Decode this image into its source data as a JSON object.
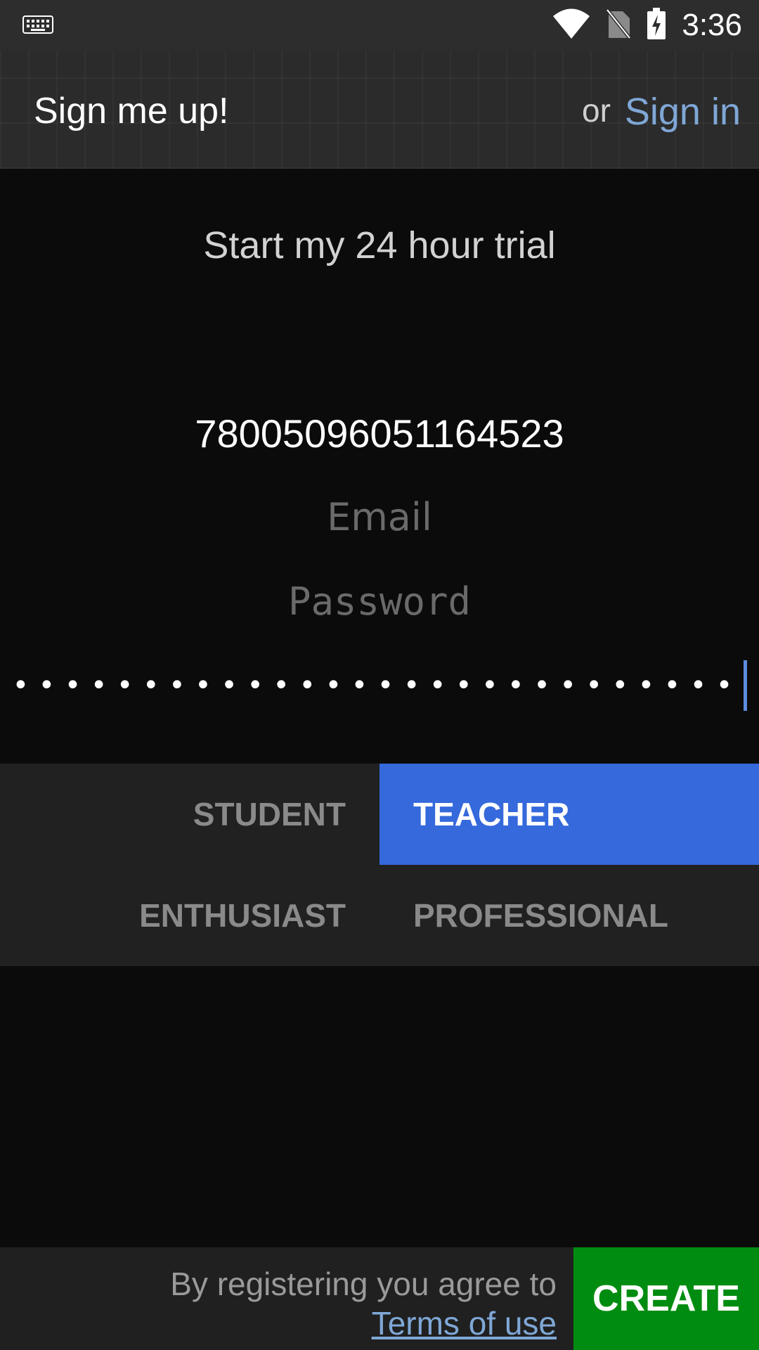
{
  "status_bar": {
    "time": "3:36",
    "icons": [
      "keyboard-icon",
      "wifi-icon",
      "no-sim-icon",
      "battery-charging-icon"
    ]
  },
  "header": {
    "title": "Sign me up!",
    "or_text": "or",
    "sign_in_label": "Sign in"
  },
  "form": {
    "trial_text": "Start my 24 hour trial",
    "name_value": "78005096051164523",
    "email_placeholder": "Email",
    "password_placeholder": "Password",
    "confirm_password_masked": "••••••••••••••••••••••••••••"
  },
  "roles": {
    "items": [
      "STUDENT",
      "TEACHER",
      "ENTHUSIAST",
      "PROFESSIONAL"
    ],
    "selected": "TEACHER"
  },
  "footer": {
    "agree_text": "By registering you agree to",
    "terms_label": "Terms of use",
    "create_label": "CREATE"
  },
  "colors": {
    "accent_blue": "#3569dc",
    "link_blue": "#7fa7d6",
    "create_green": "#008c10"
  }
}
